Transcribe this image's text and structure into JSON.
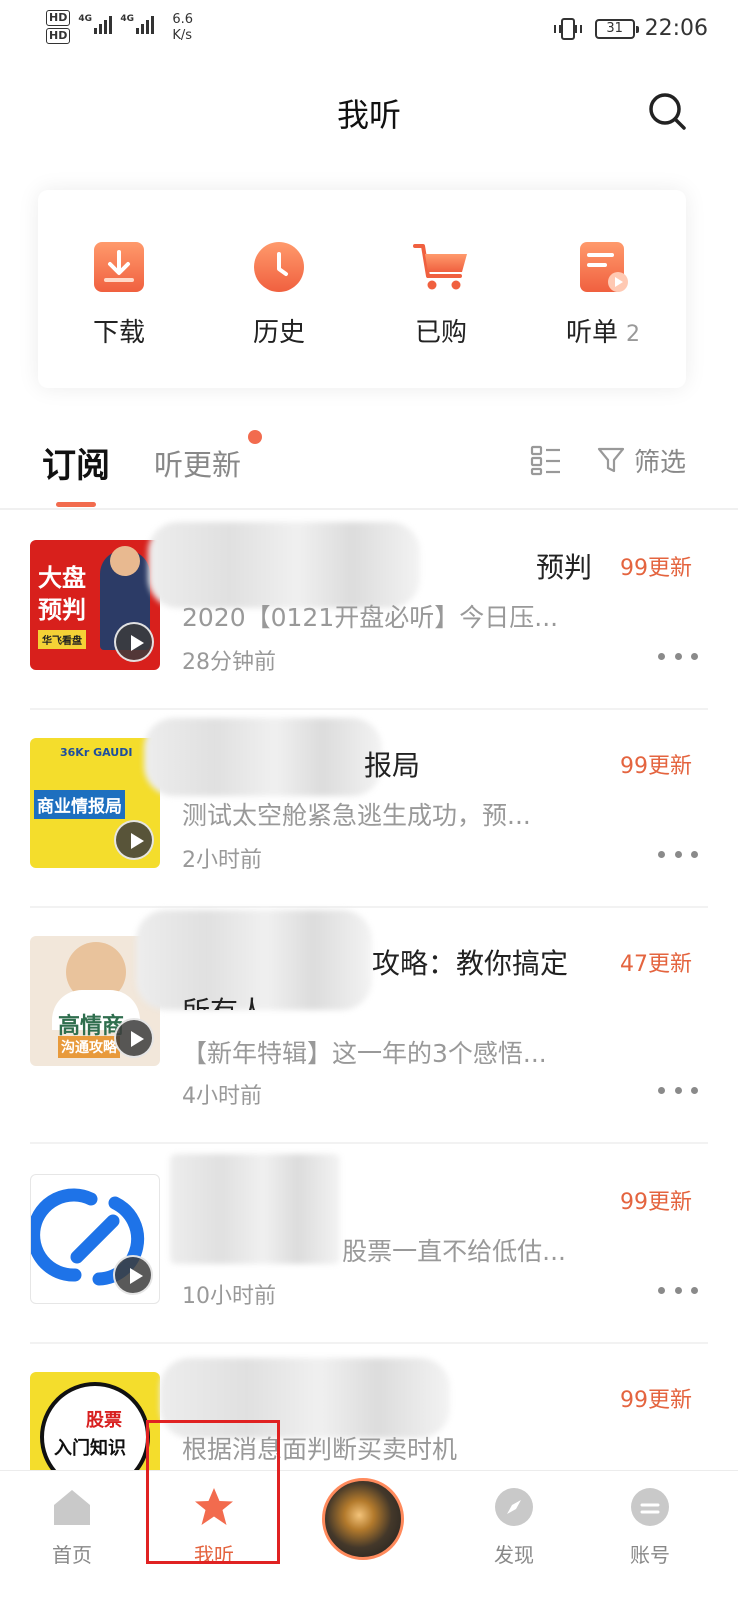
{
  "status_bar": {
    "hd1": "HD",
    "hd2": "HD",
    "net1": "4G",
    "net2": "4G",
    "speed_value": "6.6",
    "speed_unit": "K/s",
    "battery": "31",
    "time": "22:06"
  },
  "header": {
    "title": "我听",
    "search_icon": "search-icon"
  },
  "quick_actions": [
    {
      "label": "下载",
      "icon": "download-icon",
      "count": ""
    },
    {
      "label": "历史",
      "icon": "clock-icon",
      "count": ""
    },
    {
      "label": "已购",
      "icon": "cart-icon",
      "count": ""
    },
    {
      "label": "听单",
      "icon": "playlist-icon",
      "count": "2"
    }
  ],
  "tabs": {
    "subscribe": "订阅",
    "updates": "听更新",
    "filter": "筛选"
  },
  "items": [
    {
      "title": "预判",
      "desc": "2020【0121开盘必听】今日压...",
      "time": "28分钟前",
      "badge": "99更新",
      "cover_lines": [
        "大盘",
        "预判"
      ],
      "cover_sub": "华飞看盘"
    },
    {
      "title": "报局",
      "desc": "测试太空舱紧急逃生成功，预...",
      "time": "2小时前",
      "badge": "99更新",
      "cover_lines": [
        "商业情报局"
      ],
      "cover_sub": "36Kr GAUDI"
    },
    {
      "title": "攻略：教你搞定",
      "title2": "所有人",
      "desc": "【新年特辑】这一年的3个感悟...",
      "time": "4小时前",
      "badge": "47更新",
      "cover_lines": [
        "高情商",
        "沟通攻略"
      ],
      "cover_sub": ""
    },
    {
      "title": "",
      "desc": "股票一直不给低估...",
      "time": "10小时前",
      "badge": "99更新",
      "cover_lines": [],
      "cover_sub": ""
    },
    {
      "title": "",
      "desc": "根据消息面判断买卖时机",
      "time": "",
      "badge": "99更新",
      "cover_lines": [
        "股票",
        "入门知识"
      ],
      "cover_sub": ""
    }
  ],
  "bottom_nav": [
    {
      "label": "首页",
      "icon": "home-icon"
    },
    {
      "label": "我听",
      "icon": "star-icon"
    },
    {
      "label": "",
      "icon": "player-disc-icon"
    },
    {
      "label": "发现",
      "icon": "compass-icon"
    },
    {
      "label": "账号",
      "icon": "account-icon"
    }
  ],
  "colors": {
    "accent": "#f26b4e",
    "badge": "#e4643f",
    "highlight_box": "#e02222"
  }
}
